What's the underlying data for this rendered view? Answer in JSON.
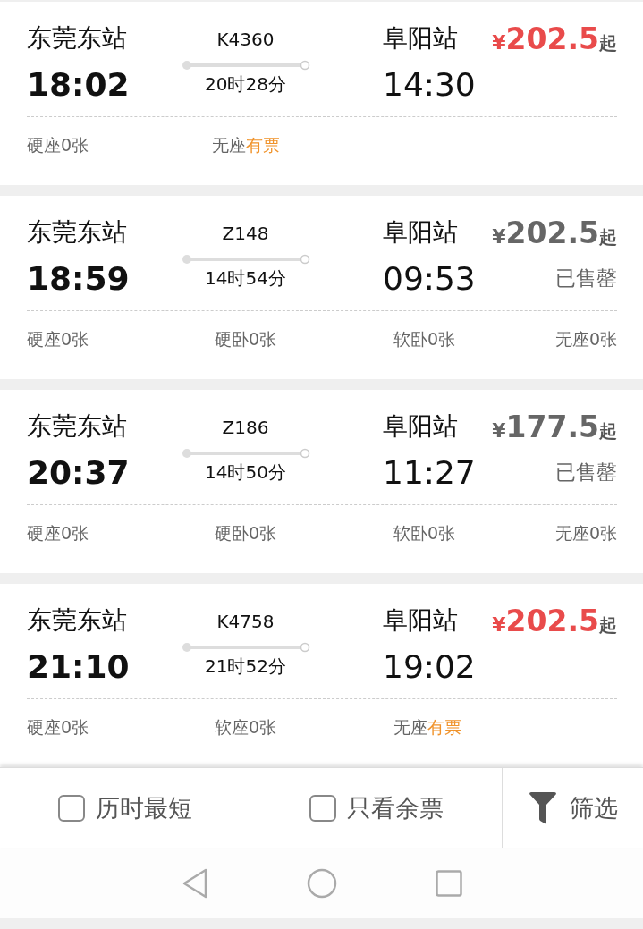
{
  "trains": [
    {
      "from": "东莞东站",
      "depart": "18:02",
      "number": "K4360",
      "duration": "20时28分",
      "to": "阜阳站",
      "arrive": "14:30",
      "price": {
        "currency": "¥",
        "amount": "202.5",
        "suffix": "起"
      },
      "sold_out": false,
      "seats": [
        {
          "text": "硬座0张"
        },
        {
          "text": "无座",
          "available": "有票"
        }
      ]
    },
    {
      "from": "东莞东站",
      "depart": "18:59",
      "number": "Z148",
      "duration": "14时54分",
      "to": "阜阳站",
      "arrive": "09:53",
      "price": {
        "currency": "¥",
        "amount": "202.5",
        "suffix": "起"
      },
      "sold_out": true,
      "status": "已售罄",
      "seats": [
        {
          "text": "硬座0张"
        },
        {
          "text": "硬卧0张"
        },
        {
          "text": "软卧0张"
        },
        {
          "text": "无座0张"
        }
      ]
    },
    {
      "from": "东莞东站",
      "depart": "20:37",
      "number": "Z186",
      "duration": "14时50分",
      "to": "阜阳站",
      "arrive": "11:27",
      "price": {
        "currency": "¥",
        "amount": "177.5",
        "suffix": "起"
      },
      "sold_out": true,
      "status": "已售罄",
      "seats": [
        {
          "text": "硬座0张"
        },
        {
          "text": "硬卧0张"
        },
        {
          "text": "软卧0张"
        },
        {
          "text": "无座0张"
        }
      ]
    },
    {
      "from": "东莞东站",
      "depart": "21:10",
      "number": "K4758",
      "duration": "21时52分",
      "to": "阜阳站",
      "arrive": "19:02",
      "price": {
        "currency": "¥",
        "amount": "202.5",
        "suffix": "起"
      },
      "sold_out": false,
      "seats": [
        {
          "text": "硬座0张"
        },
        {
          "text": "软座0张"
        },
        {
          "text": "无座",
          "available": "有票"
        }
      ]
    }
  ],
  "bottom_bar": {
    "options": [
      {
        "label": "历时最短",
        "checked": false
      },
      {
        "label": "只看余票",
        "checked": false
      }
    ],
    "filter": {
      "label": "筛选"
    }
  }
}
